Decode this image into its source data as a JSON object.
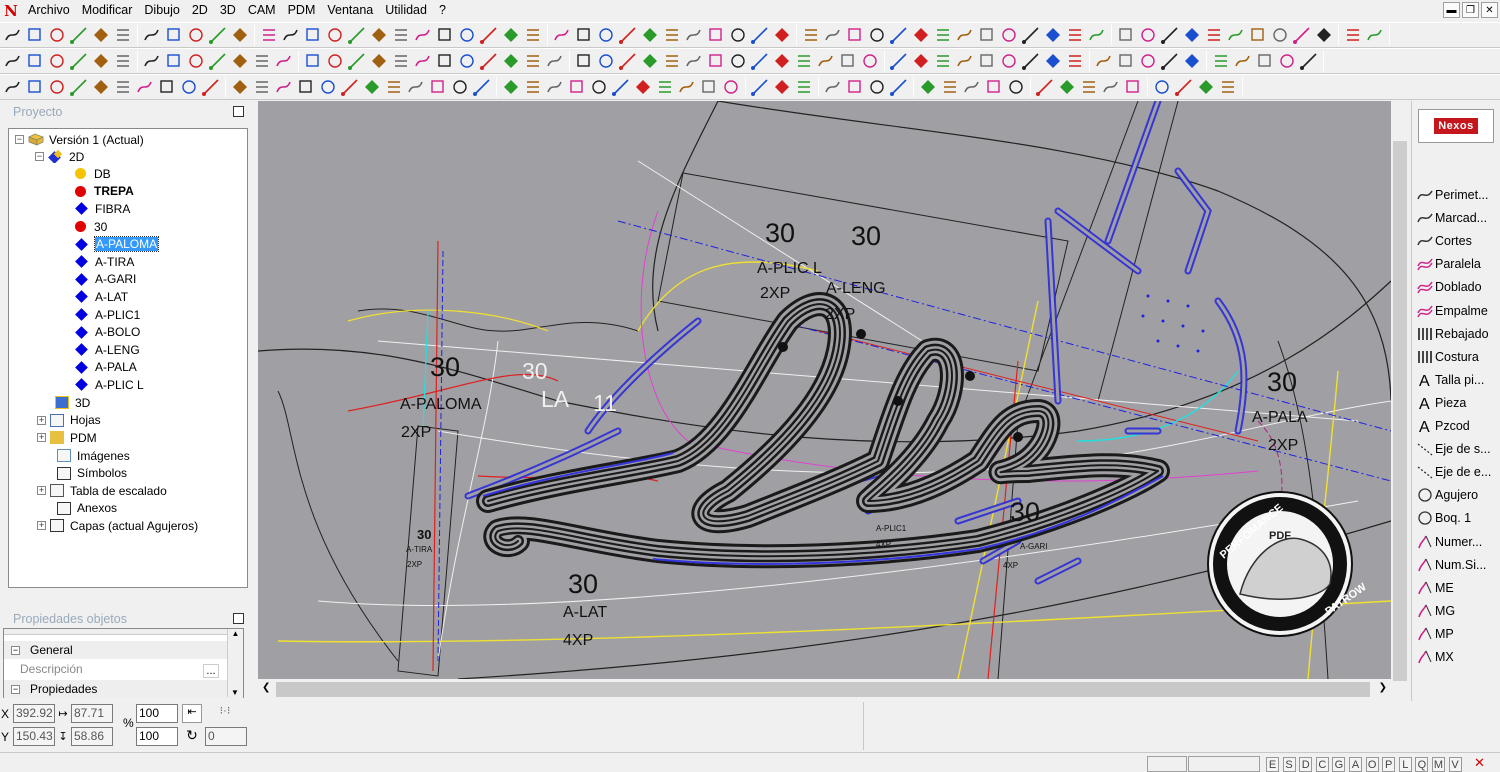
{
  "menu": {
    "items": [
      "Archivo",
      "Modificar",
      "Dibujo",
      "2D",
      "3D",
      "CAM",
      "PDM",
      "Ventana",
      "Utilidad",
      "?"
    ]
  },
  "project_panel": {
    "title": "Proyecto",
    "root": "Versión 1 (Actual)",
    "group_2d": "2D",
    "layers": [
      {
        "label": "DB",
        "color": "#f5c400",
        "shape": "dot",
        "bold": false
      },
      {
        "label": "TREPA",
        "color": "#e00000",
        "shape": "dot",
        "bold": true
      },
      {
        "label": "FIBRA",
        "color": "#0000e0",
        "shape": "diamond",
        "bold": false
      },
      {
        "label": "30",
        "color": "#e00000",
        "shape": "dot",
        "bold": false
      },
      {
        "label": "A-PALOMA",
        "color": "#0000e0",
        "shape": "diamond",
        "bold": false,
        "selected": true
      },
      {
        "label": "A-TIRA",
        "color": "#0000e0",
        "shape": "diamond",
        "bold": false
      },
      {
        "label": "A-GARI",
        "color": "#0000e0",
        "shape": "diamond",
        "bold": false
      },
      {
        "label": "A-LAT",
        "color": "#0000e0",
        "shape": "diamond",
        "bold": false
      },
      {
        "label": "A-PLIC1",
        "color": "#0000e0",
        "shape": "diamond",
        "bold": false
      },
      {
        "label": "A-BOLO",
        "color": "#0000e0",
        "shape": "diamond",
        "bold": false
      },
      {
        "label": "A-LENG",
        "color": "#0000e0",
        "shape": "diamond",
        "bold": false
      },
      {
        "label": "A-PALA",
        "color": "#0000e0",
        "shape": "diamond",
        "bold": false
      },
      {
        "label": "A-PLIC L",
        "color": "#0000e0",
        "shape": "diamond",
        "bold": false
      }
    ],
    "other_nodes": [
      "3D",
      "Hojas",
      "PDM",
      "Imágenes",
      "Símbolos",
      "Tabla de escalado",
      "Anexos",
      "Capas (actual Agujeros)"
    ]
  },
  "properties_panel": {
    "title": "Propiedades objetos",
    "general": "General",
    "description_label": "Descripción",
    "description_btn": "...",
    "properties": "Propiedades"
  },
  "coords": {
    "x_label": "X",
    "y_label": "Y",
    "x": "392.92",
    "y": "150.43",
    "dx": "87.71",
    "dy": "58.86",
    "pct_label": "%",
    "scale_x": "100",
    "scale_y": "100",
    "rotation": "0"
  },
  "canvas": {
    "texts": [
      {
        "t": "30",
        "cls": "big"
      },
      {
        "t": "30",
        "cls": "big"
      },
      {
        "t": "A-PLIC L",
        "cls": "mid"
      },
      {
        "t": "2XP",
        "cls": "mid"
      },
      {
        "t": "A-LENG",
        "cls": "mid"
      },
      {
        "t": "2XP",
        "cls": "mid"
      },
      {
        "t": "30",
        "cls": "big"
      },
      {
        "t": "A-PALOMA",
        "cls": "mid"
      },
      {
        "t": "2XP",
        "cls": "mid"
      },
      {
        "t": "30",
        "cls": "white"
      },
      {
        "t": "LA",
        "cls": "white"
      },
      {
        "t": "11",
        "cls": "white"
      },
      {
        "t": "30",
        "cls": "big"
      },
      {
        "t": "A-PALA",
        "cls": "mid"
      },
      {
        "t": "2XP",
        "cls": "mid"
      },
      {
        "t": "30",
        "cls": "small"
      },
      {
        "t": "A-TIRA",
        "cls": "tiny"
      },
      {
        "t": "2XP",
        "cls": "tiny"
      },
      {
        "t": "30",
        "cls": "big"
      },
      {
        "t": "A-LAT",
        "cls": "mid"
      },
      {
        "t": "4XP",
        "cls": "mid"
      },
      {
        "t": "A-PLIC1",
        "cls": "tiny"
      },
      {
        "t": "4XP",
        "cls": "tiny"
      },
      {
        "t": "30",
        "cls": "big"
      },
      {
        "t": "A-GARI",
        "cls": "tiny"
      },
      {
        "t": "4XP",
        "cls": "tiny"
      }
    ],
    "watermark": {
      "top": "PERFOMANCE",
      "center": "PDF",
      "bottom": "PATROW"
    }
  },
  "right_panel": {
    "brand": "Nexos",
    "items": [
      {
        "label": "Perimet...",
        "icon": "curve-icon",
        "color": "#333"
      },
      {
        "label": "Marcad...",
        "icon": "curve-icon",
        "color": "#333"
      },
      {
        "label": "Cortes",
        "icon": "curve-icon",
        "color": "#333"
      },
      {
        "label": "Paralela",
        "icon": "double-curve-icon",
        "color": "#d0208a"
      },
      {
        "label": "Doblado",
        "icon": "double-curve-icon",
        "color": "#d0208a"
      },
      {
        "label": "Empalme",
        "icon": "double-curve-icon",
        "color": "#d0208a"
      },
      {
        "label": "Rebajado",
        "icon": "hatch-icon",
        "color": "#333"
      },
      {
        "label": "Costura",
        "icon": "hatch-icon",
        "color": "#333"
      },
      {
        "label": "Talla pi...",
        "icon": "text-a-icon",
        "color": "#000"
      },
      {
        "label": "Pieza",
        "icon": "text-a-icon",
        "color": "#000"
      },
      {
        "label": "Pzcod",
        "icon": "text-a-icon",
        "color": "#000"
      },
      {
        "label": "Eje de s...",
        "icon": "dashed-line-icon",
        "color": "#333"
      },
      {
        "label": "Eje de e...",
        "icon": "dashed-line-icon",
        "color": "#333"
      },
      {
        "label": "Agujero",
        "icon": "circle-icon",
        "color": "#333"
      },
      {
        "label": "Boq. 1",
        "icon": "circle-icon",
        "color": "#333"
      },
      {
        "label": "Numer...",
        "icon": "pen-curve-icon",
        "color": "#d0208a"
      },
      {
        "label": "Num.Si...",
        "icon": "pen-curve-icon",
        "color": "#d0208a"
      },
      {
        "label": "ME",
        "icon": "pen-curve-icon",
        "color": "#d0208a"
      },
      {
        "label": "MG",
        "icon": "pen-curve-icon",
        "color": "#d0208a"
      },
      {
        "label": "MP",
        "icon": "pen-curve-icon",
        "color": "#d0208a"
      },
      {
        "label": "MX",
        "icon": "pen-curve-icon",
        "color": "#d0208a"
      }
    ]
  },
  "status": {
    "snap_keys": [
      "E",
      "S",
      "D",
      "C",
      "G",
      "A",
      "O",
      "P",
      "L",
      "Q",
      "M",
      "V"
    ]
  }
}
